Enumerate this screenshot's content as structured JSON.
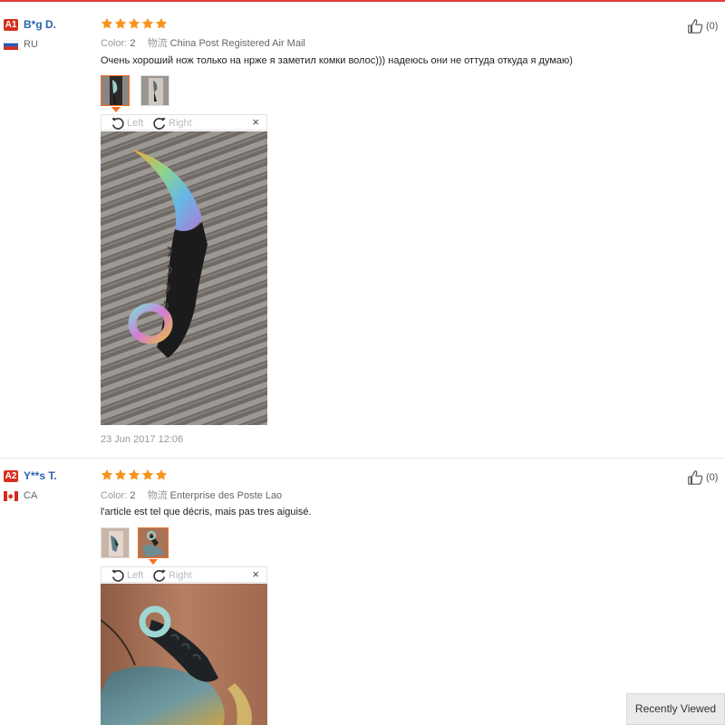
{
  "reviews": [
    {
      "level": "A1",
      "username": "B*g D.",
      "country": "RU",
      "color_label": "Color:",
      "color_value": "2",
      "shipping_label": "物流",
      "shipping_value": "China Post Registered Air Mail",
      "text": "Очень хороший нож только на нрже я заметил комки волос))) надеюсь они не оттуда откуда я думаю)",
      "rotate_left": "Left",
      "rotate_right": "Right",
      "close": "×",
      "date": "23 Jun 2017 12:06",
      "likes": "(0)",
      "stars": 5
    },
    {
      "level": "A2",
      "username": "Y**s T.",
      "country": "CA",
      "color_label": "Color:",
      "color_value": "2",
      "shipping_label": "物流",
      "shipping_value": "Enterprise des Poste Lao",
      "text": "l'article est tel que décris, mais pas tres aiguisé.",
      "rotate_left": "Left",
      "rotate_right": "Right",
      "close": "×",
      "likes": "(0)",
      "stars": 5
    }
  ],
  "recently_viewed": "Recently Viewed",
  "colors": {
    "accent": "#f46d24",
    "star": "#f7941d",
    "level_badge": "#d7301f",
    "username": "#2b64ad"
  }
}
